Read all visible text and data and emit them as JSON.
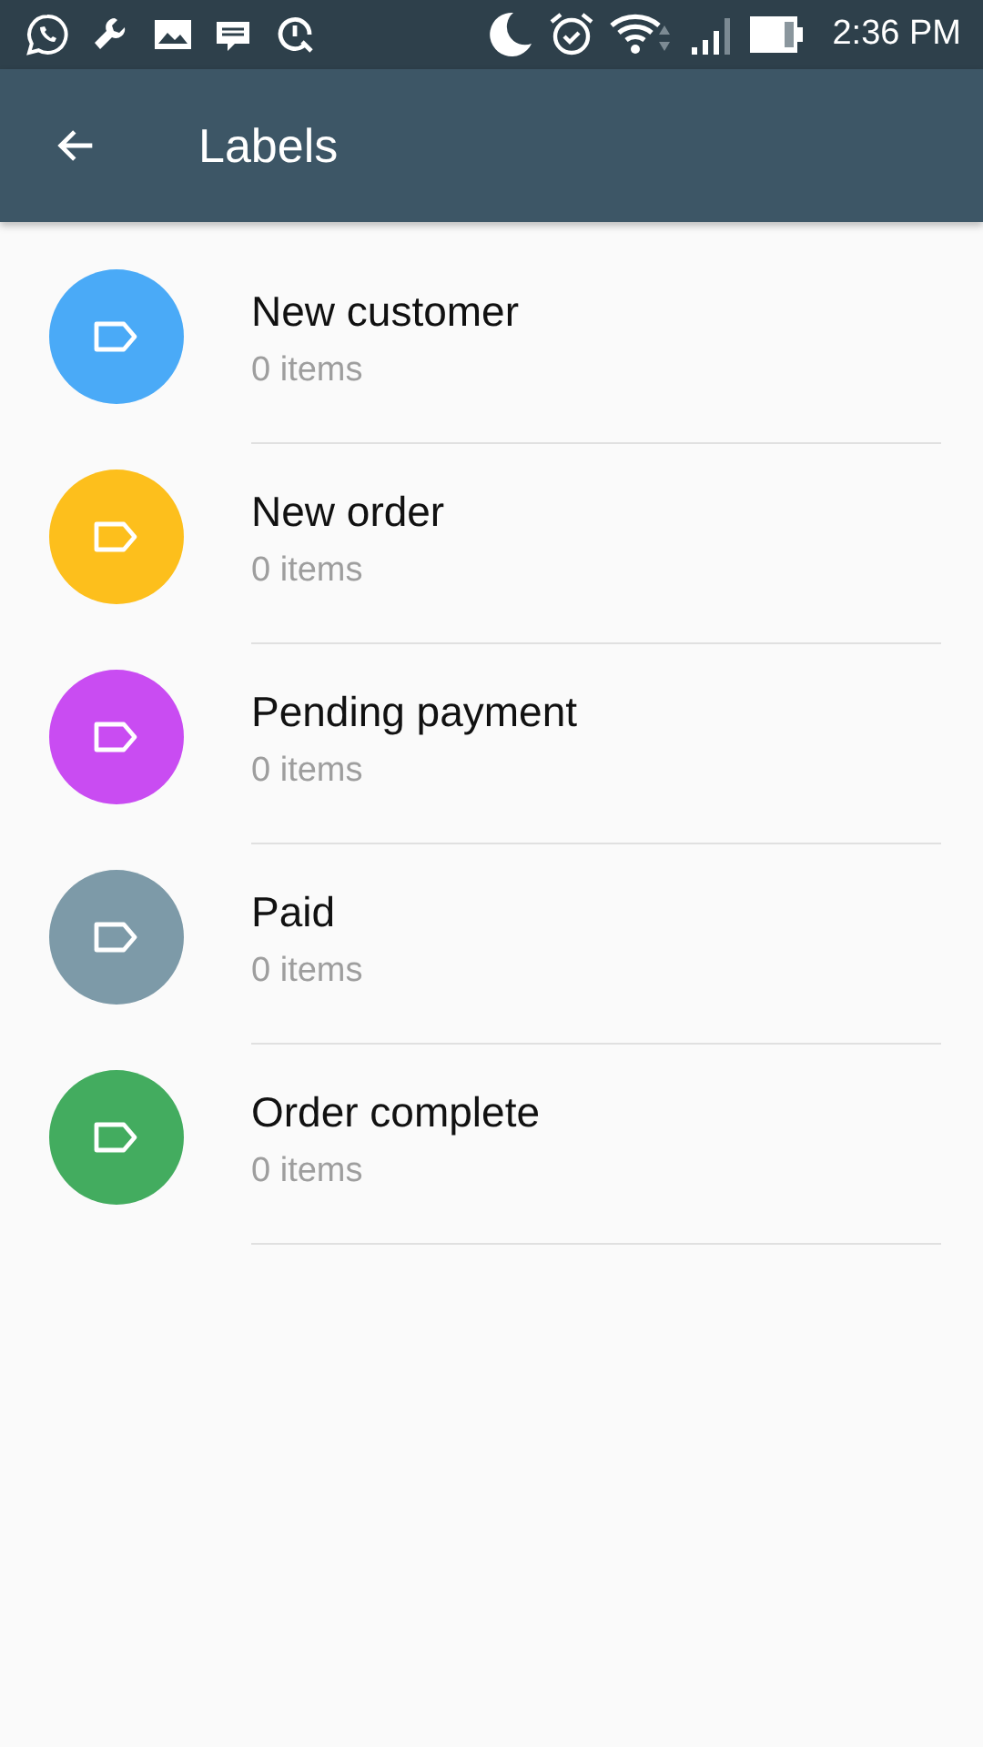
{
  "status_bar": {
    "time": "2:36 PM"
  },
  "app_bar": {
    "title": "Labels"
  },
  "labels": [
    {
      "name": "New customer",
      "count": "0 items",
      "color": "#4aaaf7"
    },
    {
      "name": "New order",
      "count": "0 items",
      "color": "#fdbf1c"
    },
    {
      "name": "Pending payment",
      "count": "0 items",
      "color": "#c94cf2"
    },
    {
      "name": "Paid",
      "count": "0 items",
      "color": "#7d9aa8"
    },
    {
      "name": "Order complete",
      "count": "0 items",
      "color": "#43ac5f"
    }
  ]
}
